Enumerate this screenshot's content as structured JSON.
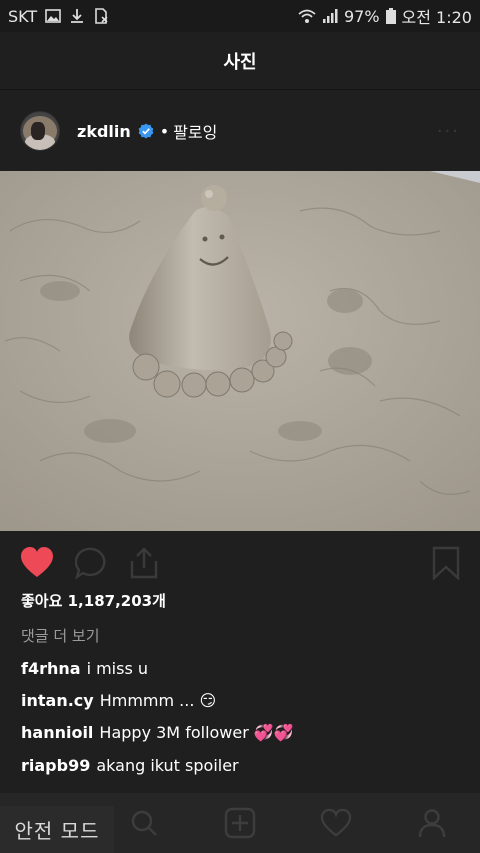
{
  "status_bar": {
    "carrier": "SKT",
    "battery": "97%",
    "time": "오전 1:20",
    "icons": [
      "image-icon",
      "download-icon",
      "no-sim-icon",
      "wifi-icon",
      "signal-icon",
      "battery-icon"
    ]
  },
  "header": {
    "title": "사진"
  },
  "post": {
    "username": "zkdlin",
    "separator": "•",
    "follow_label": "팔로잉",
    "more_label": "···",
    "verified_icon": "verified-badge-icon"
  },
  "actions": {
    "icons": [
      "heart-icon",
      "comment-icon",
      "share-icon",
      "bookmark-icon"
    ],
    "liked": true,
    "like_color": "#ed4956"
  },
  "likes_text": "좋아요 1,187,203개",
  "view_comments": "댓글 더 보기",
  "comments": [
    {
      "user": "f4rhna",
      "text": "i miss u"
    },
    {
      "user": "intan.cy",
      "text": "Hmmmm ... 😏"
    },
    {
      "user": "hannioil",
      "text": "Happy 3M follower 💞💞"
    },
    {
      "user": "riapb99",
      "text": "akang ikut spoiler"
    }
  ],
  "bottom_nav": {
    "items": [
      "home-icon",
      "search-icon",
      "add-post-icon",
      "activity-heart-icon",
      "profile-icon"
    ]
  },
  "safe_mode_label": "안전 모드"
}
